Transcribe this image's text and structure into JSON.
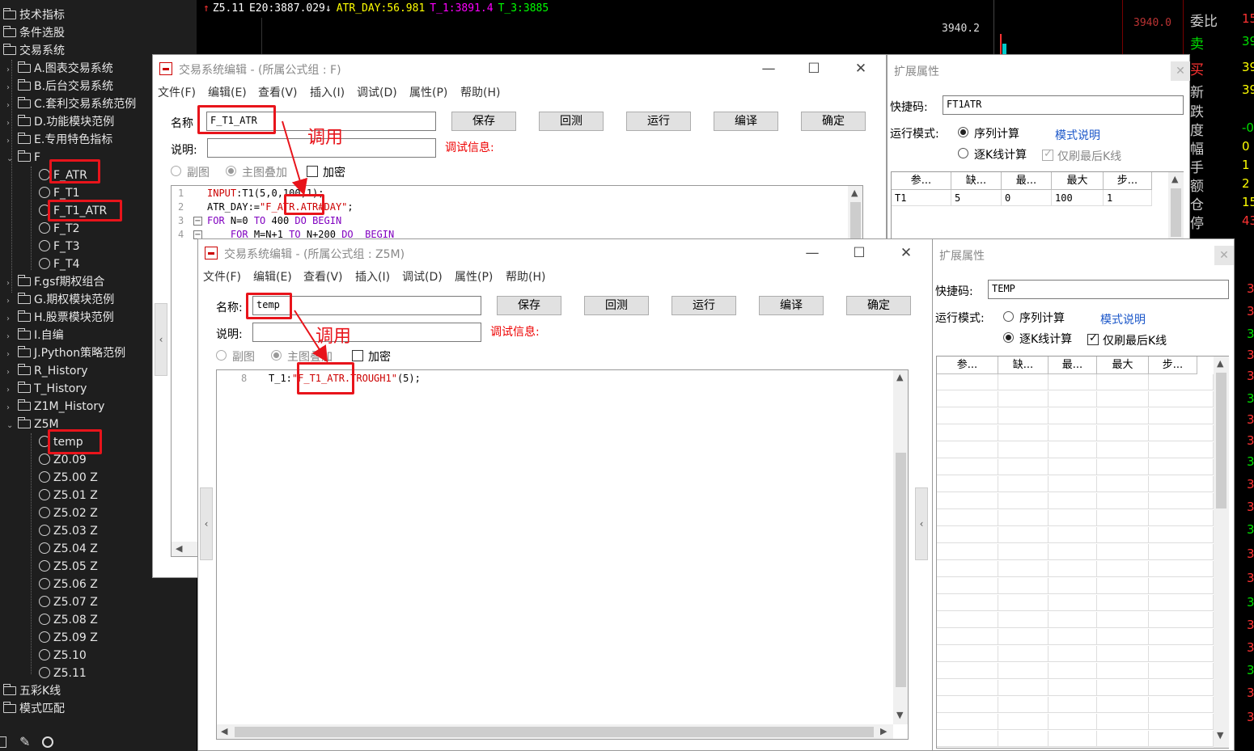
{
  "sidebar": {
    "items": [
      {
        "label": "技术指标"
      },
      {
        "label": "条件选股"
      },
      {
        "label": "交易系统"
      },
      {
        "label": "A.图表交易系统"
      },
      {
        "label": "B.后台交易系统"
      },
      {
        "label": "C.套利交易系统范例"
      },
      {
        "label": "D.功能模块范例"
      },
      {
        "label": "E.专用特色指标"
      },
      {
        "label": "F"
      },
      {
        "label": "F_ATR"
      },
      {
        "label": "F_T1"
      },
      {
        "label": "F_T1_ATR"
      },
      {
        "label": "F_T2"
      },
      {
        "label": "F_T3"
      },
      {
        "label": "F_T4"
      },
      {
        "label": "F.gsf期权组合"
      },
      {
        "label": "G.期权模块范例"
      },
      {
        "label": "H.股票模块范例"
      },
      {
        "label": "I.自编"
      },
      {
        "label": "J.Python策略范例"
      },
      {
        "label": "R_History"
      },
      {
        "label": "T_History"
      },
      {
        "label": "Z1M_History"
      },
      {
        "label": "Z5M"
      },
      {
        "label": "temp"
      },
      {
        "label": "Z0.09"
      },
      {
        "label": "Z5.00 Z"
      },
      {
        "label": "Z5.01 Z"
      },
      {
        "label": "Z5.02 Z"
      },
      {
        "label": "Z5.03 Z"
      },
      {
        "label": "Z5.04 Z"
      },
      {
        "label": "Z5.05 Z"
      },
      {
        "label": "Z5.06 Z"
      },
      {
        "label": "Z5.07 Z"
      },
      {
        "label": "Z5.08 Z"
      },
      {
        "label": "Z5.09 Z"
      },
      {
        "label": "Z5.10"
      },
      {
        "label": "Z5.11"
      },
      {
        "label": "五彩K线"
      },
      {
        "label": "模式匹配"
      }
    ]
  },
  "chart": {
    "indicators": [
      {
        "text": "Z5.11",
        "color": "#ffffff"
      },
      {
        "text": "E20:3887.029↓",
        "color": "#ffffff"
      },
      {
        "text": "ATR_DAY:56.981",
        "color": "#ffff00"
      },
      {
        "text": "T_1:3891.4",
        "color": "#ff00ff"
      },
      {
        "text": "T_3:3885",
        "color": "#00ff00"
      }
    ],
    "price_label": "3940.2",
    "right_price": "3940.0"
  },
  "quote_panel": {
    "rows": [
      {
        "label": "委比",
        "value": "15",
        "color": "#ff3333"
      },
      {
        "label": "卖",
        "value": "39",
        "color": "#00e000"
      },
      {
        "label": "买",
        "value": "39",
        "color": "#ffff00"
      },
      {
        "label": "新",
        "value": "39",
        "color": "#ffff00"
      },
      {
        "label": "跌",
        "value": "",
        "color": "#00e000"
      },
      {
        "label": "度",
        "value": "-0",
        "color": "#00e000"
      },
      {
        "label": "幅",
        "value": "0",
        "color": "#ffff00"
      },
      {
        "label": "手",
        "value": "1",
        "color": "#ffff00"
      },
      {
        "label": "额",
        "value": "2",
        "color": "#ffff00"
      },
      {
        "label": "仓",
        "value": "15",
        "color": "#ffff00"
      },
      {
        "label": "停",
        "value": "43",
        "color": "#ff3333"
      }
    ]
  },
  "win1": {
    "title": "交易系统编辑 - (所属公式组 : F)",
    "menus": [
      "文件(F)",
      "编辑(E)",
      "查看(V)",
      "插入(I)",
      "调试(D)",
      "属性(P)",
      "帮助(H)"
    ],
    "name_label": "名称",
    "name_value": "F_T1_ATR",
    "desc_label": "说明:",
    "debug_label": "调试信息:",
    "buttons": [
      "保存",
      "回测",
      "运行",
      "编译",
      "确定"
    ],
    "opt_sub": "副图",
    "opt_main": "主图叠加",
    "opt_encrypt": "加密",
    "code_lines": [
      {
        "n": "1",
        "t": "INPUT:T1(5,0,100,1);"
      },
      {
        "n": "2",
        "t": "ATR_DAY:=\"F_ATR.ATR#DAY\";"
      },
      {
        "n": "3",
        "t": "FOR N=0 TO 400 DO BEGIN"
      },
      {
        "n": "4",
        "t": "    FOR M=N+1 TO N+200 DO  BEGIN"
      }
    ],
    "callout": "调用"
  },
  "ext1": {
    "title": "扩展属性",
    "hotkey_label": "快捷码:",
    "hotkey_value": "FT1ATR",
    "mode_label": "运行模式:",
    "mode_seq": "序列计算",
    "mode_kline": "逐K线计算",
    "mode_link": "模式说明",
    "refresh_last": "仅刷最后K线",
    "grid_headers": [
      "参...",
      "缺...",
      "最...",
      "最大",
      "步..."
    ],
    "grid_rows": [
      [
        "T1",
        "5",
        "0",
        "100",
        "1"
      ]
    ]
  },
  "win2": {
    "title": "交易系统编辑 - (所属公式组 : Z5M)",
    "menus": [
      "文件(F)",
      "编辑(E)",
      "查看(V)",
      "插入(I)",
      "调试(D)",
      "属性(P)",
      "帮助(H)"
    ],
    "name_label": "名称:",
    "name_value": "temp",
    "desc_label": "说明:",
    "debug_label": "调试信息:",
    "buttons": [
      "保存",
      "回测",
      "运行",
      "编译",
      "确定"
    ],
    "opt_sub": "副图",
    "opt_main": "主图叠加",
    "opt_encrypt": "加密",
    "code_line_num": "8",
    "code_prefix": "T_1:",
    "code_str": "\"F_T1_ATR.TROUGH1\"",
    "code_suffix": "(5);",
    "callout": "调用"
  },
  "ext2": {
    "title": "扩展属性",
    "hotkey_label": "快捷码:",
    "hotkey_value": "TEMP",
    "mode_label": "运行模式:",
    "mode_seq": "序列计算",
    "mode_kline": "逐K线计算",
    "mode_link": "模式说明",
    "refresh_last": "仅刷最后K线",
    "grid_headers": [
      "参...",
      "缺...",
      "最...",
      "最大",
      "步..."
    ]
  }
}
